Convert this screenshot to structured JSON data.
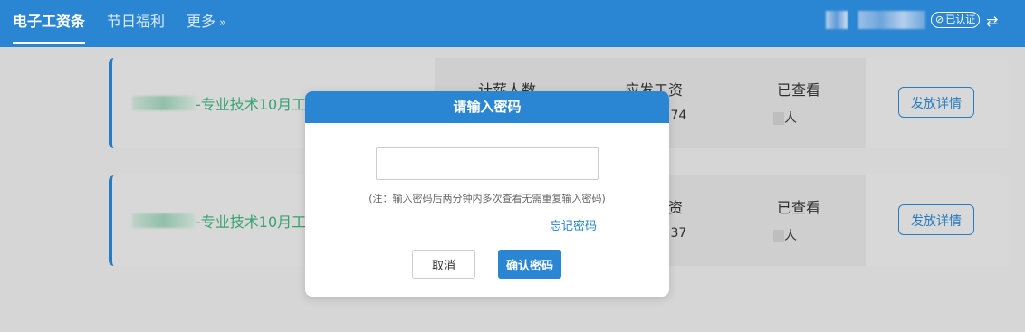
{
  "nav": {
    "tabs": [
      {
        "label": "电子工资条",
        "active": true
      },
      {
        "label": "节日福利",
        "active": false
      },
      {
        "label": "更多",
        "active": false
      }
    ],
    "more_arrow": "»",
    "cert_label": "已认证",
    "swap_icon": "⇄"
  },
  "cards": [
    {
      "title_suffix": "-专业技术10月工",
      "labels": {
        "count": "计薪人数",
        "salary": "应发工资",
        "viewed": "已查看"
      },
      "salary_value_tail": ".74",
      "viewed_unit": "人",
      "detail_button": "发放详情"
    },
    {
      "title_suffix": "-专业技术10月工",
      "labels": {
        "salary_tail": "资",
        "viewed": "已查看"
      },
      "salary_value_tail": ".37",
      "viewed_unit": "人",
      "detail_button": "发放详情"
    }
  ],
  "modal": {
    "title": "请输入密码",
    "password_value": "",
    "note": "(注：输入密码后两分钟内多次查看无需重复输入密码)",
    "forgot_link": "忘记密码",
    "cancel_button": "取消",
    "confirm_button": "确认密码"
  },
  "colors": {
    "primary": "#2a86d2",
    "title_green": "#3bb27a",
    "background": "#e9e9e9"
  }
}
